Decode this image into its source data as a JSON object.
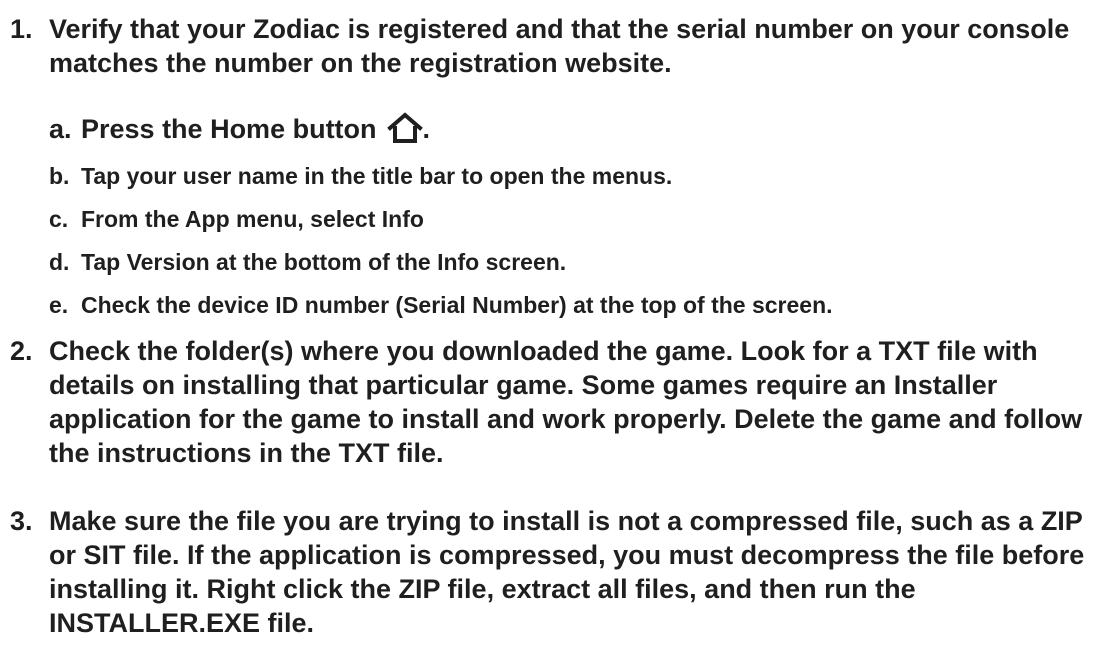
{
  "steps": [
    {
      "number": "1.",
      "text": "Verify that your Zodiac is registered and that the serial number on your console matches the number on the registration website.",
      "substeps": [
        {
          "letter": "a.",
          "text": "Press the Home button",
          "suffix": ".",
          "icon": "home-icon"
        },
        {
          "letter": "b.",
          "text": "Tap your user name in the title bar to open the menus."
        },
        {
          "letter": "c.",
          "text": "From the App menu, select Info"
        },
        {
          "letter": "d.",
          "text": "Tap Version at the bottom of the Info screen."
        },
        {
          "letter": "e.",
          "text": "Check the device ID number (Serial Number) at the top of the screen."
        }
      ]
    },
    {
      "number": "2.",
      "text": "Check the folder(s) where you downloaded the game. Look for a TXT file with details on installing that particular game. Some games require an Installer application for the game to install and work properly. Delete the game and follow the instructions in the TXT file."
    },
    {
      "number": "3.",
      "text": "Make sure the file you are trying to install is not a compressed file, such as a ZIP or SIT file. If the application is compressed, you must decompress the file before installing it. Right click the ZIP file, extract all files, and then run the INSTALLER.EXE file."
    }
  ]
}
